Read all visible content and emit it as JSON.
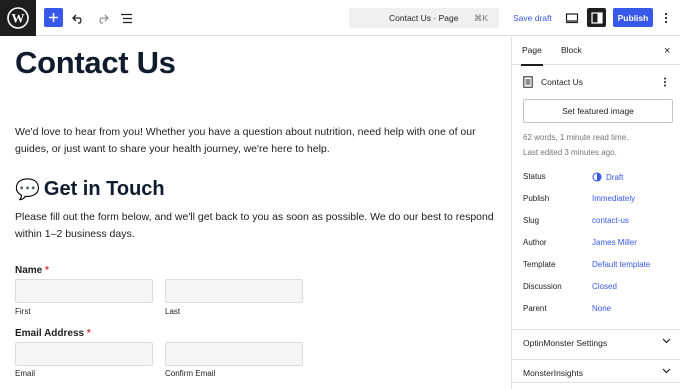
{
  "topbar": {
    "document_title": "Contact Us · Page",
    "shortcut": "⌘K",
    "save_draft": "Save draft",
    "publish": "Publish",
    "icons": [
      "wordpress-logo",
      "plus-icon",
      "undo-icon",
      "redo-icon",
      "list-view-icon",
      "desktop-view-icon",
      "settings-icon",
      "more-options-icon"
    ]
  },
  "editor": {
    "title": "Contact Us",
    "intro": "We'd love to hear from you! Whether you have a question about nutrition, need help with one of our guides, or just want to share your health journey, we're here to help.",
    "heading_emoji": "💬",
    "heading": "Get in Touch",
    "form_description": "Please fill out the form below, and we'll get back to you as soon as possible. We do our best to respond within 1–2 business days.",
    "form": {
      "name_label": "Name",
      "name_first": "First",
      "name_last": "Last",
      "email_label": "Email Address",
      "email_sub": "Email",
      "email_confirm_sub": "Confirm Email",
      "required_marker": "*"
    }
  },
  "sidebar": {
    "tabs": [
      "Page",
      "Block"
    ],
    "active_tab": "Page",
    "close": "×",
    "doc_title": "Contact Us",
    "featured_image_button": "Set featured image",
    "word_count": "62 words, 1 minute read time.",
    "last_edited": "Last edited 3 minutes ago.",
    "properties": [
      {
        "label": "Status",
        "value": "Draft"
      },
      {
        "label": "Publish",
        "value": "Immediately"
      },
      {
        "label": "Slug",
        "value": "contact-us"
      },
      {
        "label": "Author",
        "value": "James Miller"
      },
      {
        "label": "Template",
        "value": "Default template"
      },
      {
        "label": "Discussion",
        "value": "Closed"
      },
      {
        "label": "Parent",
        "value": "None"
      }
    ],
    "panels": [
      "OptinMonster Settings",
      "MonsterInsights"
    ]
  },
  "colors": {
    "accent": "#3858e9",
    "dark": "#1e1e1e",
    "required": "#d63638"
  }
}
